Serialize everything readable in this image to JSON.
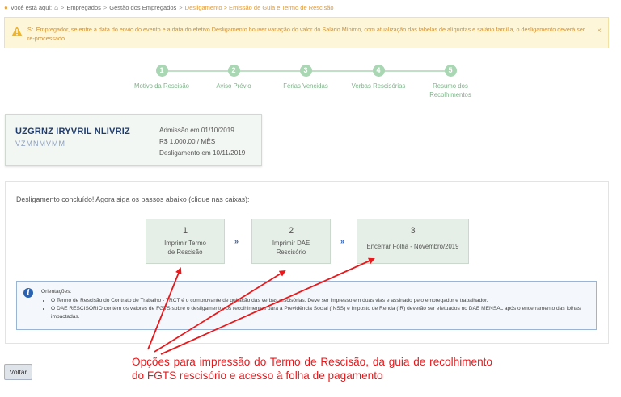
{
  "breadcrumb": {
    "prefix": "Você está aqui:",
    "items": [
      "Empregados",
      "Gestão dos Empregados"
    ],
    "current": "Desligamento > Emissão de Guia e Termo de Rescisão",
    "separator": ">"
  },
  "alert": {
    "message": "Sr. Empregador, se entre a data do envio do evento e a data do efetivo Desligamento houver variação do valor do Salário Mínimo, com atualização das tabelas de alíquotas e salário família, o desligamento deverá ser re-processado.",
    "close": "×"
  },
  "steps": [
    {
      "number": "1",
      "label": "Motivo da Rescisão"
    },
    {
      "number": "2",
      "label": "Aviso Prévio"
    },
    {
      "number": "3",
      "label": "Férias Vencidas"
    },
    {
      "number": "4",
      "label": "Verbas Rescisórias"
    },
    {
      "number": "5",
      "label": "Resumo dos Recolhimentos"
    }
  ],
  "employee": {
    "name": "UZGRNZ IRYVRIL NLIVRIZ",
    "subtitle": "VZMNMVMM",
    "admission": "Admissão em 01/10/2019",
    "salary": "R$ 1.000,00 / MÊS",
    "dismissal": "Desligamento em 10/11/2019"
  },
  "panel": {
    "intro": "Desligamento concluído! Agora siga os passos abaixo (clique nas caixas):",
    "actions": [
      {
        "number": "1",
        "label_line1": "Imprimir Termo",
        "label_line2": "de Rescisão"
      },
      {
        "number": "2",
        "label_line1": "Imprimir DAE",
        "label_line2": "Rescisório"
      },
      {
        "number": "3",
        "label_line1": "Encerrar Folha - Novembro/2019",
        "label_line2": ""
      }
    ],
    "chevron": "››",
    "notes": {
      "title": "Orientações:",
      "items": [
        "O Termo de Rescisão do Contrato de Trabalho - TRCT é o comprovante de quitação das verbas rescisórias. Deve ser impresso em duas vias e assinado pelo empregador e trabalhador.",
        "O DAE RESCISÓRIO contém os valores de FGTS sobre o desligamento, os recolhimentos para a Previdência Social (INSS) e Imposto de Renda (IR) deverão ser efetuados no DAE MENSAL após o encerramento das folhas impactadas."
      ]
    }
  },
  "buttons": {
    "back": "Voltar"
  },
  "annotation": "Opções para impressão do Termo de Rescisão, da guia de recolhimento do FGTS rescisório e acesso à folha de pagamento",
  "colors": {
    "accent": "#e39a2f",
    "step": "#a9d6b3",
    "annotation": "#e8191c",
    "info": "#2b62b0"
  },
  "icons": {
    "home": "home-icon",
    "warning": "warning-icon",
    "close": "close-icon",
    "info": "info-icon"
  }
}
